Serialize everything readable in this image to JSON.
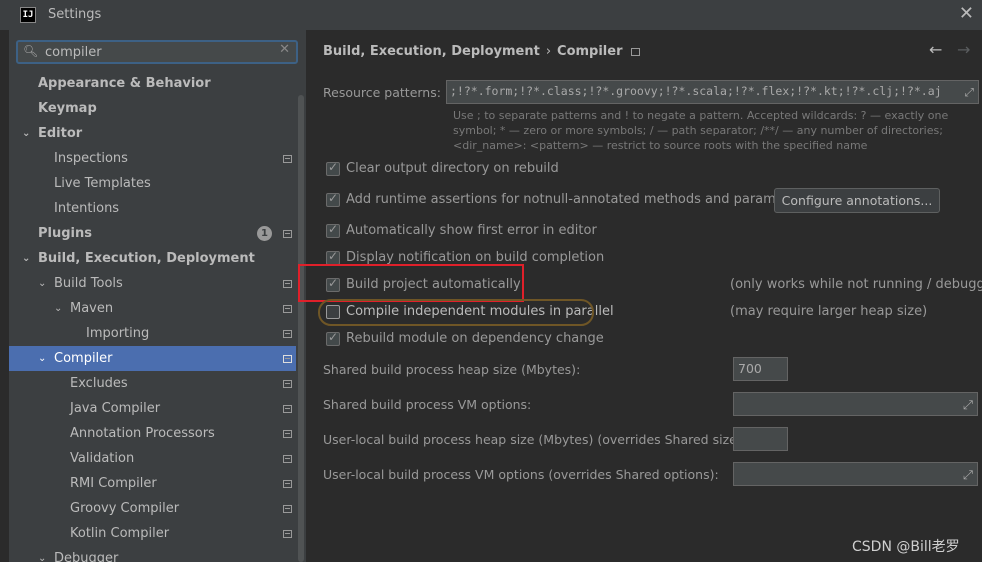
{
  "window": {
    "title": "Settings",
    "app_icon": "IJ"
  },
  "search": {
    "value": "compiler"
  },
  "tree": [
    {
      "label": "Appearance & Behavior"
    },
    {
      "label": "Keymap"
    },
    {
      "label": "Editor"
    },
    {
      "label": "Inspections"
    },
    {
      "label": "Live Templates"
    },
    {
      "label": "Intentions"
    },
    {
      "label": "Plugins",
      "badge": "1"
    },
    {
      "label": "Build, Execution, Deployment"
    },
    {
      "label": "Build Tools"
    },
    {
      "label": "Maven"
    },
    {
      "label": "Importing"
    },
    {
      "label": "Compiler"
    },
    {
      "label": "Excludes"
    },
    {
      "label": "Java Compiler"
    },
    {
      "label": "Annotation Processors"
    },
    {
      "label": "Validation"
    },
    {
      "label": "RMI Compiler"
    },
    {
      "label": "Groovy Compiler"
    },
    {
      "label": "Kotlin Compiler"
    },
    {
      "label": "Debugger"
    }
  ],
  "breadcrumb": {
    "parent": "Build, Execution, Deployment",
    "separator": "›",
    "current": "Compiler"
  },
  "resource_patterns": {
    "label": "Resource patterns:",
    "value": ";!?*.form;!?*.class;!?*.groovy;!?*.scala;!?*.flex;!?*.kt;!?*.clj;!?*.aj",
    "hint": "Use ; to separate patterns and ! to negate a pattern. Accepted wildcards: ? — exactly one symbol; * — zero or more symbols; / — path separator; /**/ — any number of directories; <dir_name>: <pattern> — restrict to source roots with the specified name"
  },
  "options": {
    "clear_output": {
      "label": "Clear output directory on rebuild",
      "checked": true
    },
    "runtime_assertions": {
      "label": "Add runtime assertions for notnull-annotated methods and parameters",
      "checked": true
    },
    "configure_annotations": "Configure annotations...",
    "show_first_error": {
      "label": "Automatically show first error in editor",
      "checked": true
    },
    "display_notification": {
      "label": "Display notification on build completion",
      "checked": true
    },
    "build_automatically": {
      "label": "Build project automatically",
      "checked": true,
      "note": "(only works while not running / debugging)"
    },
    "compile_parallel": {
      "label": "Compile independent modules in parallel",
      "checked": false,
      "note": "(may require larger heap size)"
    },
    "rebuild_dependency": {
      "label": "Rebuild module on dependency change",
      "checked": true
    }
  },
  "fields": {
    "shared_heap_label": "Shared build process heap size (Mbytes):",
    "shared_heap_value": "700",
    "shared_vm_label": "Shared build process VM options:",
    "local_heap_label": "User-local build process heap size (Mbytes) (overrides Shared size):",
    "local_vm_label": "User-local build process VM options (overrides Shared options):"
  },
  "watermark": "CSDN @Bill老罗"
}
